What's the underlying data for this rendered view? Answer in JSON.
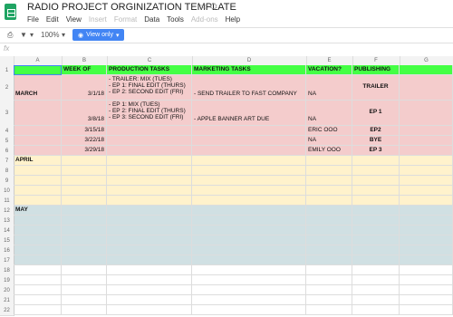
{
  "title": "RADIO PROJECT ORGINIZATION TEMPLATE",
  "menu": [
    "File",
    "Edit",
    "View",
    "Insert",
    "Format",
    "Data",
    "Tools",
    "Add-ons",
    "Help"
  ],
  "menu_disabled": [
    "Insert",
    "Format",
    "Add-ons"
  ],
  "toolbar": {
    "zoom": "100%",
    "view_only": "View only"
  },
  "fx_label": "fx",
  "columns": [
    "A",
    "B",
    "C",
    "D",
    "E",
    "F",
    "G"
  ],
  "headers": {
    "week_of": "WEEK OF",
    "production": "PRODUCTION TASKS",
    "marketing": "MARKETING TASKS",
    "vacation": "VACATION?",
    "publishing": "PUBLISHING"
  },
  "rows": {
    "r2": {
      "month": "MARCH",
      "week": "3/1/18",
      "prod": [
        "- TRAILER: MIX (TUES)",
        "- EP 1: FINAL EDIT (THURS)",
        "- EP 2: SECOND EDIT (FRI)"
      ],
      "mkt": "- SEND TRAILER TO FAST COMPANY",
      "vac": "NA",
      "pub": "TRAILER"
    },
    "r3": {
      "week": "3/8/18",
      "prod": [
        "- EP 1: MIX (TUES)",
        "- EP 2: FINAL EDIT (THURS)",
        "- EP 3: SECOND EDIT (FRI)"
      ],
      "mkt": "- APPLE BANNER ART DUE",
      "vac": "NA",
      "pub": "EP 1"
    },
    "r4": {
      "week": "3/15/18",
      "vac": "ERIC OOO",
      "pub": "EP2"
    },
    "r5": {
      "week": "3/22/18",
      "vac": "NA",
      "pub": "BYE"
    },
    "r6": {
      "week": "3/29/18",
      "vac": "EMILY OOO",
      "pub": "EP 3"
    },
    "r7": {
      "month": "APRIL"
    },
    "r12": {
      "month": "MAY"
    }
  },
  "row_numbers": [
    "1",
    "2",
    "3",
    "4",
    "5",
    "6",
    "7",
    "8",
    "9",
    "10",
    "11",
    "12",
    "13",
    "14",
    "15",
    "16",
    "17",
    "18",
    "19",
    "20",
    "21",
    "22",
    "23"
  ],
  "colors": {
    "header_green": "#44ff44",
    "march": "#f4cccc",
    "april": "#fff2cc",
    "may": "#d0e0e3"
  }
}
